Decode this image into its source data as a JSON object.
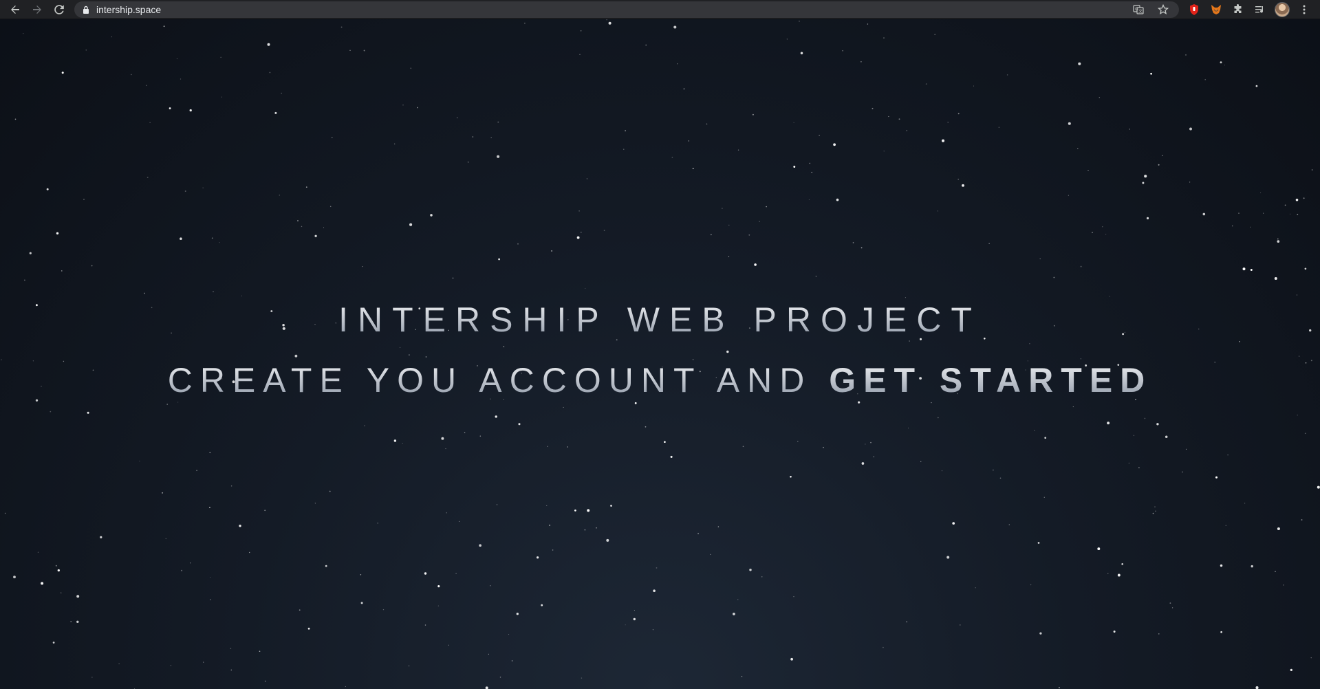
{
  "browser": {
    "url": "intership.space",
    "icons": {
      "back": "back-arrow-icon",
      "forward": "forward-arrow-icon",
      "reload": "reload-icon",
      "lock": "lock-icon",
      "translate": "translate-icon",
      "bookmark": "star-icon",
      "ext1": "red-shield-icon",
      "ext2": "fox-icon",
      "extensions": "puzzle-icon",
      "media": "media-queue-icon",
      "menu": "kebab-menu-icon"
    }
  },
  "hero": {
    "line1": "INTERSHIP WEB PROJECT",
    "line2_light": "CREATE YOU ACCOUNT AND ",
    "line2_bold": "GET STARTED"
  },
  "colors": {
    "background": "#0f131c",
    "star": "#ffffff",
    "toolbar": "#202124",
    "omnibox": "#35363a"
  }
}
